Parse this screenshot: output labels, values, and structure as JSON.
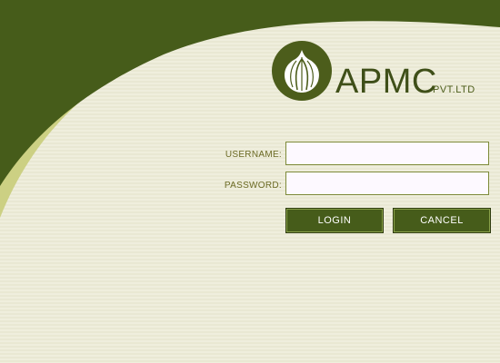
{
  "brand": {
    "name": "APMC",
    "suffix": "PVT.LTD",
    "logo_icon": "onion-icon"
  },
  "form": {
    "username_label": "USERNAME:",
    "password_label": "PASSWORD:",
    "username_value": "",
    "password_value": "",
    "login_label": "LOGIN",
    "cancel_label": "CANCEL"
  },
  "colors": {
    "primary_green": "#465c1a",
    "accent_khaki": "#ccd083",
    "background": "#efeedd"
  }
}
